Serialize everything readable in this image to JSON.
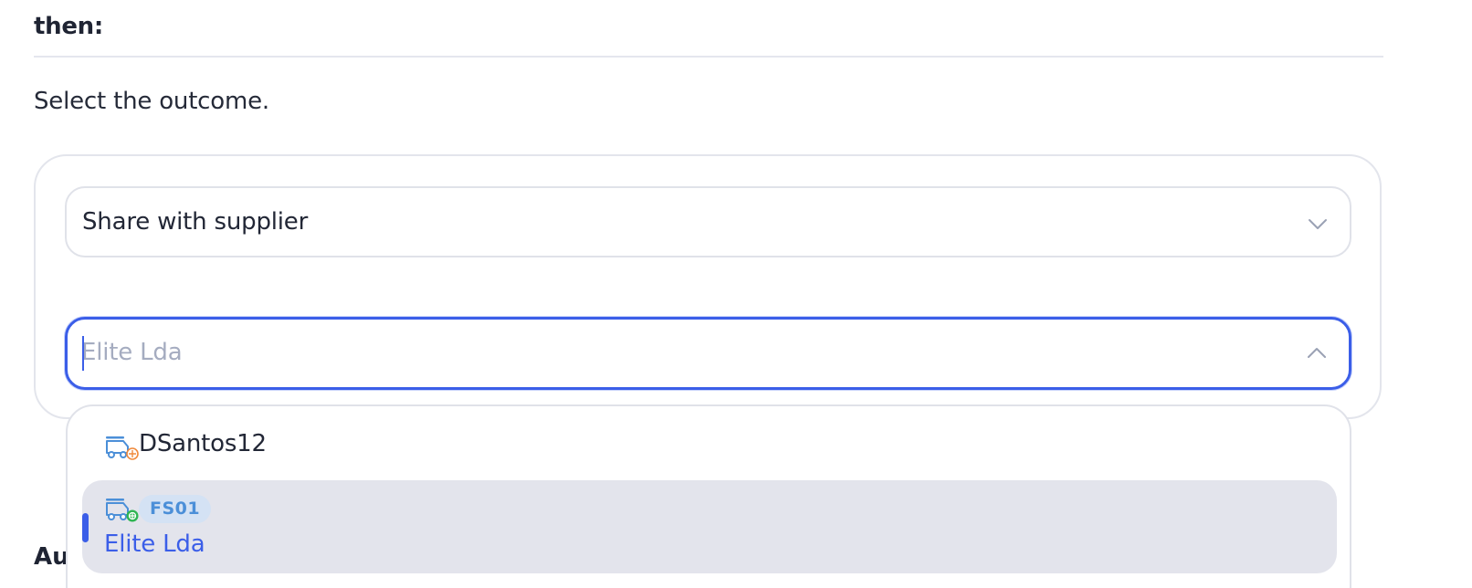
{
  "section": {
    "heading": "then:",
    "description": "Select the outcome.",
    "partial_heading": "Au"
  },
  "outcome_select": {
    "value": "Share with supplier",
    "icon": "chevron-down-icon"
  },
  "supplier_combobox": {
    "placeholder": "Elite Lda",
    "value": "",
    "icon": "chevron-up-icon"
  },
  "dropdown": {
    "options": [
      {
        "label": "DSantos12",
        "icon": "supplier-truck-icon",
        "selected": false
      },
      {
        "label": "Elite Lda",
        "badge": "FS01",
        "icon": "supplier-truck-icon",
        "selected": true
      }
    ]
  },
  "colors": {
    "accent": "#3b5ee8",
    "selected_bg": "#e3e4ec",
    "badge_bg": "#d4e2f4",
    "badge_text": "#4b8fd8",
    "icon_blue": "#4b8fd8",
    "status_orange": "#f08a3c",
    "status_green": "#2fb552"
  }
}
